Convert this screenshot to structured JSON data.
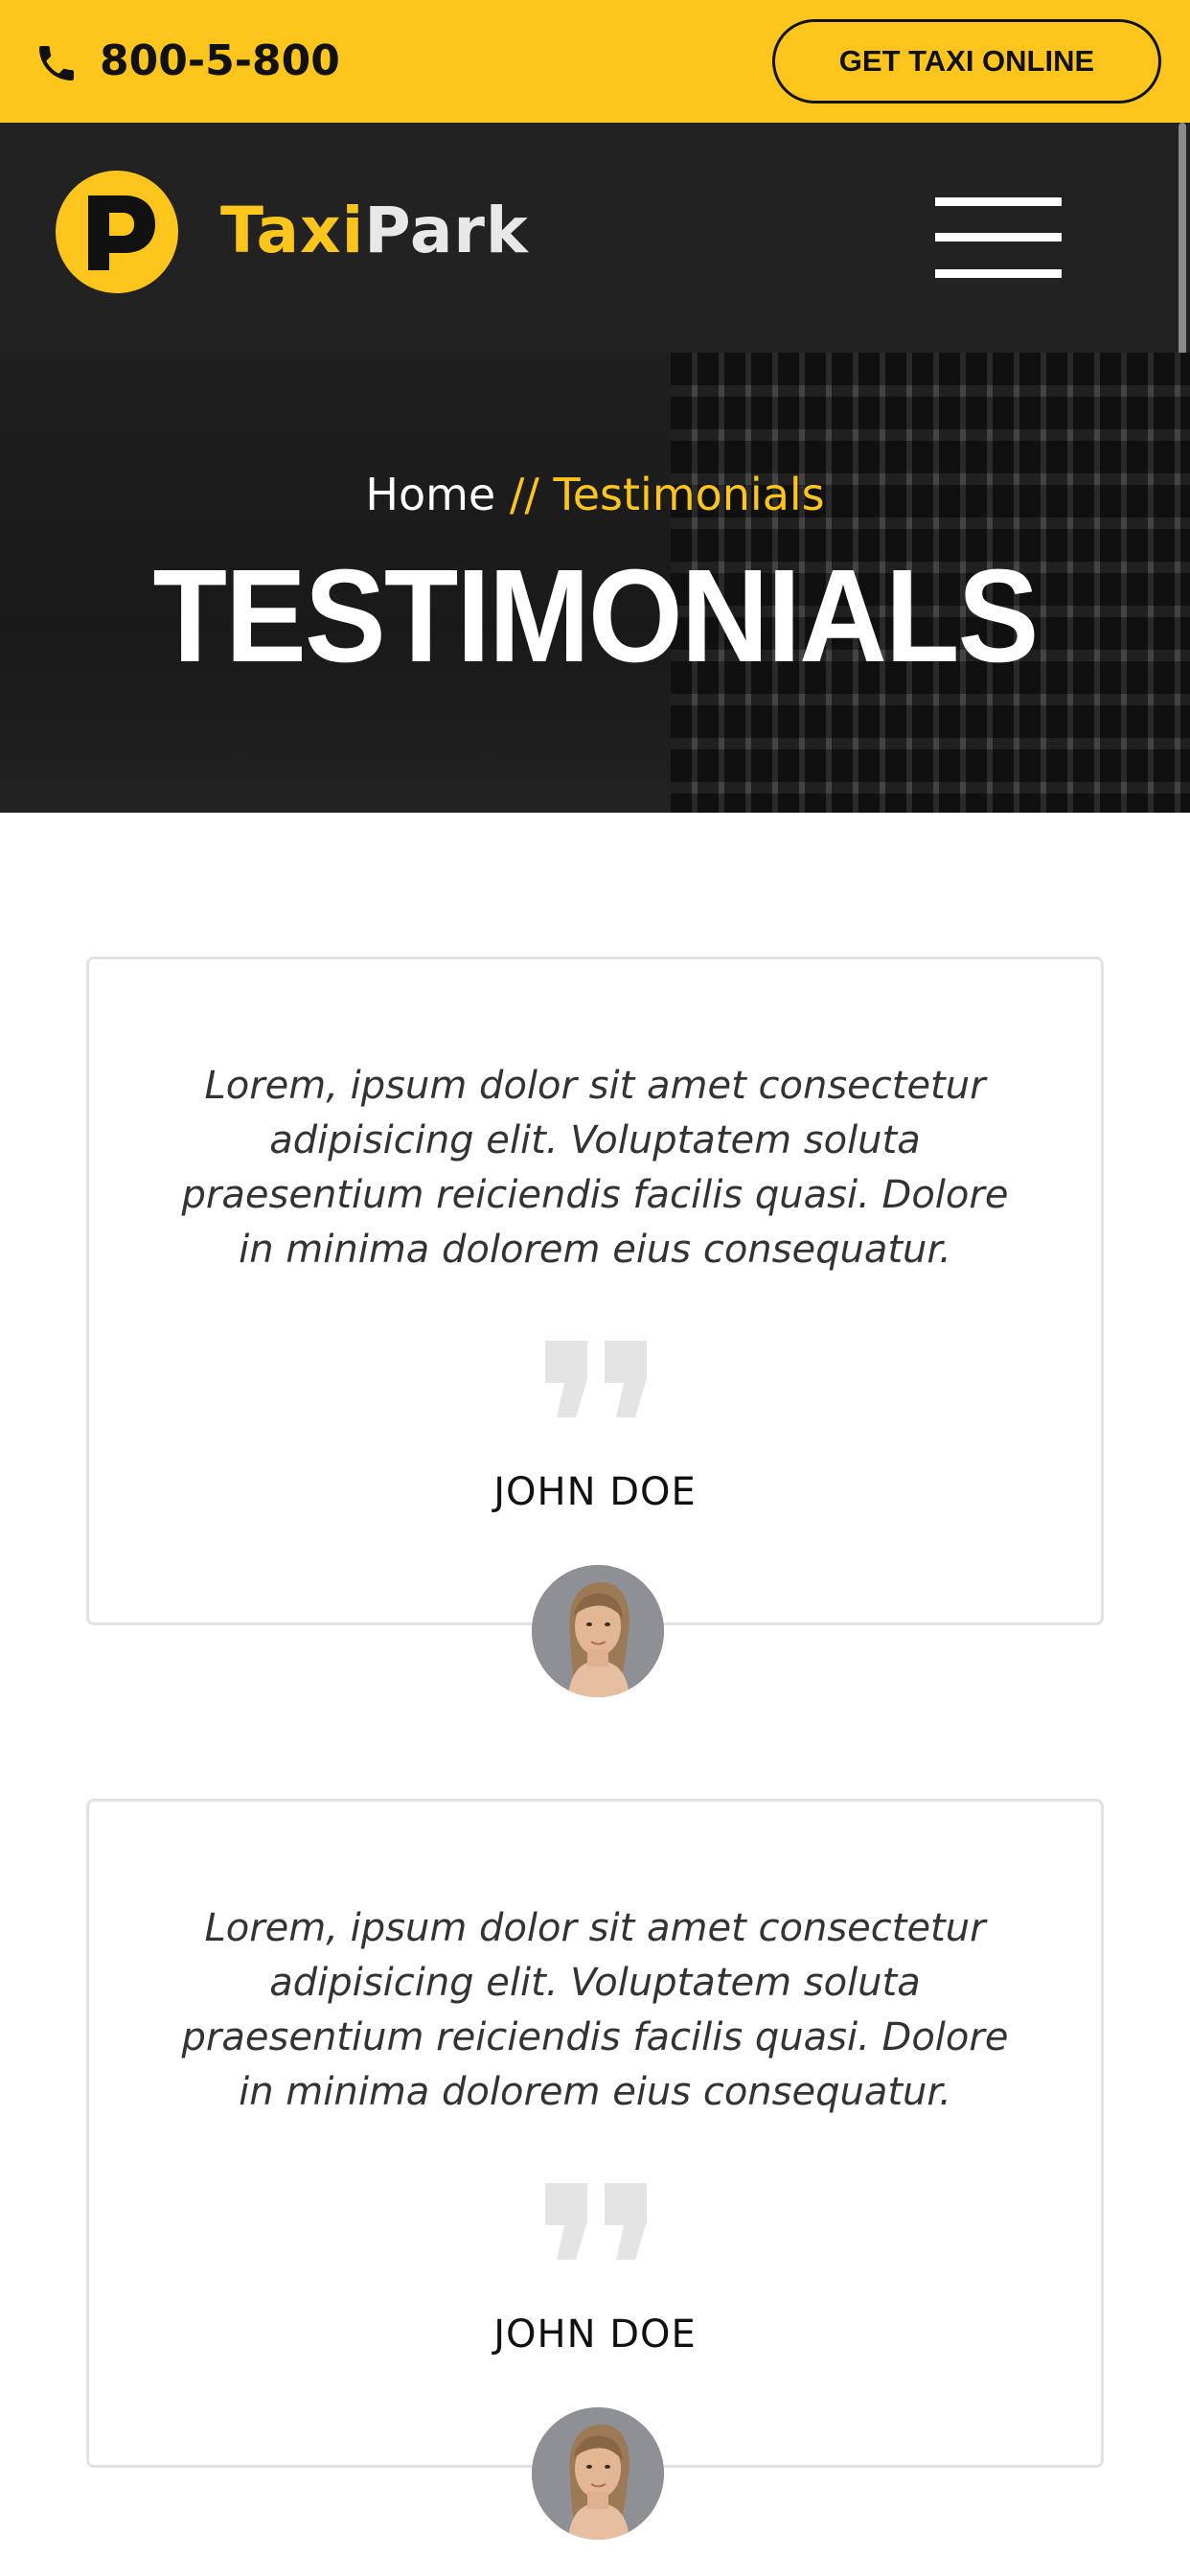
{
  "topbar": {
    "phone_icon": "phone-icon",
    "phone": "800-5-800",
    "cta_label": "GET TAXI ONLINE"
  },
  "nav": {
    "logo_letter": "P",
    "logo_taxi": "Taxi",
    "logo_park": "Park",
    "menu_icon": "hamburger-menu-icon"
  },
  "hero": {
    "breadcrumb_home": "Home",
    "breadcrumb_separator": " // ",
    "breadcrumb_current": "Testimonials",
    "title": "TESTIMONIALS"
  },
  "testimonials": [
    {
      "text": "Lorem, ipsum dolor sit amet consectetur adipisicing elit. Voluptatem soluta praesentium reiciendis facilis quasi. Dolore in minima dolorem eius consequatur.",
      "name": "JOHN DOE",
      "avatar": "woman-portrait"
    },
    {
      "text": "Lorem, ipsum dolor sit amet consectetur adipisicing elit. Voluptatem soluta praesentium reiciendis facilis quasi. Dolore in minima dolorem eius consequatur.",
      "name": "JOHN DOE",
      "avatar": "woman-portrait"
    }
  ],
  "colors": {
    "accent": "#fec61d",
    "nav_bg": "#222222",
    "card_border": "#e2e2e2"
  }
}
